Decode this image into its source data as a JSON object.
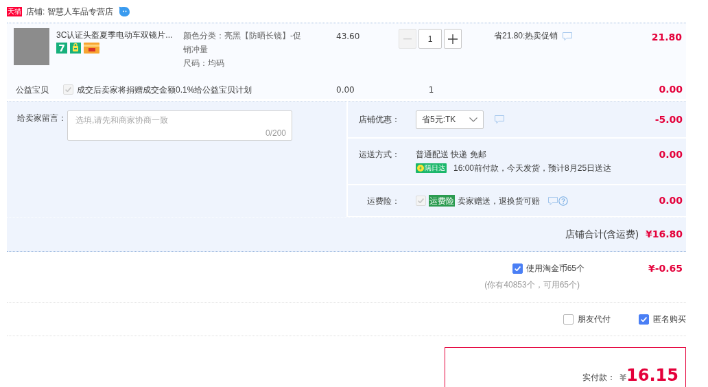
{
  "store": {
    "badge": "天猫",
    "name": "店铺: 智慧人车品专营店"
  },
  "item": {
    "name": "3C认证头盔夏季电动车双镜片...",
    "service_badges": [
      {
        "kind": "number",
        "text": "7"
      },
      {
        "kind": "bag"
      },
      {
        "kind": "card"
      }
    ],
    "specs": [
      "颜色分类：亮黑【防晒长镜】-促销冲量",
      "尺码：均码"
    ],
    "price": "43.60",
    "quantity": {
      "value": "1",
      "minus_disabled": true
    },
    "promo": "省21.80:热卖促销",
    "subtotal": "21.80"
  },
  "charity": {
    "label": "公益宝贝",
    "checked": true,
    "disabled": true,
    "text": "成交后卖家将捐赠成交金额0.1%给公益宝贝计划",
    "price": "0.00",
    "quantity": "1",
    "subtotal": "0.00"
  },
  "message": {
    "label": "给卖家留言：",
    "placeholder": "选填,请先和商家协商一致",
    "counter": "0/200"
  },
  "coupon": {
    "label": "店铺优惠：",
    "value": "省5元:TK",
    "amount": "-5.00"
  },
  "shipping": {
    "label": "运送方式：",
    "method": "普通配送 快递 免邮",
    "tag": "隔日达",
    "note": "16:00前付款，今天发货，预计8月25日送达",
    "amount": "0.00"
  },
  "insurance": {
    "label": "运费险：",
    "checked": true,
    "disabled": true,
    "tag": "运费险",
    "text": "卖家赠送，退换货可赔",
    "amount": "0.00"
  },
  "store_total": {
    "label": "店铺合计(含运费)",
    "amount": "¥16.80"
  },
  "coins": {
    "label": "使用淘金币65个",
    "checked": true,
    "amount": "¥-0.65",
    "note": "(你有40853个，可用65个)"
  },
  "options": [
    {
      "label": "朋友代付",
      "checked": false
    },
    {
      "label": "匿名购买",
      "checked": true
    }
  ],
  "payment": {
    "label": "实付款：",
    "currency": "¥",
    "amount": "16.15"
  }
}
